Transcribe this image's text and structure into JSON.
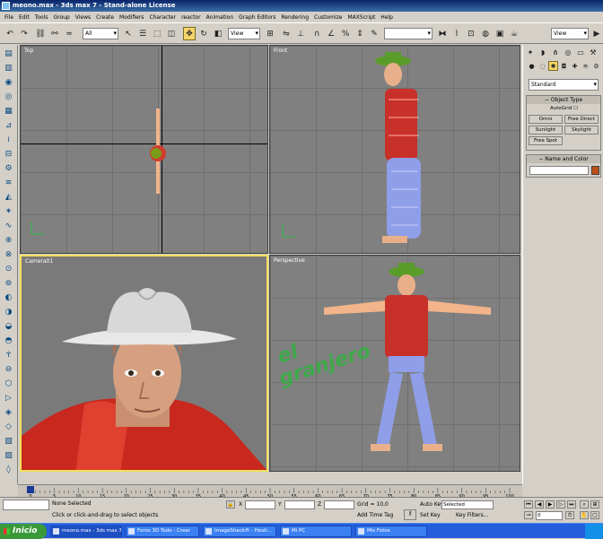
{
  "window": {
    "title": "meono.max - 3ds max 7 - Stand-alone License"
  },
  "menu": [
    "File",
    "Edit",
    "Tools",
    "Group",
    "Views",
    "Create",
    "Modifiers",
    "Character",
    "reactor",
    "Animation",
    "Graph Editors",
    "Rendering",
    "Customize",
    "MAXScript",
    "Help"
  ],
  "toolbar": {
    "selection_filter": "All",
    "ref_coord": "View",
    "named_selection": "View"
  },
  "viewports": {
    "top": {
      "label": "Top"
    },
    "front": {
      "label": "Front"
    },
    "camera": {
      "label": "Camera01"
    },
    "perspective": {
      "label": "Perspective"
    }
  },
  "overlay_text": {
    "line1": "el",
    "line2": "granjero"
  },
  "command_panel": {
    "category": "Standard",
    "object_type": {
      "title": "Object Type",
      "autogrid": "AutoGrid",
      "buttons": [
        "Omni",
        "Free Direct",
        "Sunlight",
        "Skylight",
        "Target Direct",
        "Target Spot",
        "Free Spot"
      ]
    },
    "name_color": {
      "title": "Name and Color",
      "color": "#c05018"
    }
  },
  "timeline": {
    "frame_display": "0 / 100",
    "ticks": [
      "0",
      "5",
      "10",
      "15",
      "20",
      "25",
      "30",
      "35",
      "40",
      "45",
      "50",
      "55",
      "60",
      "65",
      "70",
      "75",
      "80",
      "85",
      "90",
      "95",
      "100"
    ]
  },
  "status": {
    "selection": "None Selected",
    "prompt": "Click or click-and-drag to select objects",
    "x_label": "X",
    "y_label": "Y",
    "z_label": "Z",
    "x_value": "",
    "y_value": "",
    "z_value": "",
    "grid": "Grid = 10,0",
    "add_time_tag": "Add Time Tag",
    "autokey": "Auto Key",
    "setkey": "Set Key",
    "key_mode": "Selected",
    "key_filters": "Key Filters...",
    "current_frame": "0"
  },
  "taskbar": {
    "start": "Inicio",
    "tasks": [
      {
        "label": "meono.max - 3ds max 7"
      },
      {
        "label": "Foros 3D Todo - Crear"
      },
      {
        "label": "ImageShack® - Hosti..."
      },
      {
        "label": "Mi PC"
      },
      {
        "label": "Mis Fotos"
      }
    ]
  }
}
